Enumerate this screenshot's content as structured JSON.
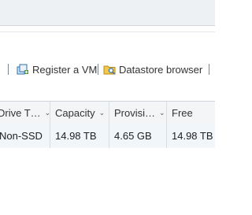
{
  "toolbar": {
    "register_vm_label": "Register a VM",
    "datastore_browser_label": "Datastore browser"
  },
  "table": {
    "columns": [
      {
        "label": "Drive T…",
        "chevron": "⌄"
      },
      {
        "label": "Capacity",
        "chevron": "⌄"
      },
      {
        "label": "Provisi…",
        "chevron": "⌄"
      },
      {
        "label": "Free",
        "chevron": "⌄"
      }
    ],
    "rows": [
      {
        "drive_type": "Non-SSD",
        "capacity": "14.98 TB",
        "provisioned": "4.65 GB",
        "free": "14.98 TB"
      }
    ]
  },
  "icons": {
    "register_vm": "register-vm-icon",
    "datastore_browser": "datastore-browser-icon"
  }
}
